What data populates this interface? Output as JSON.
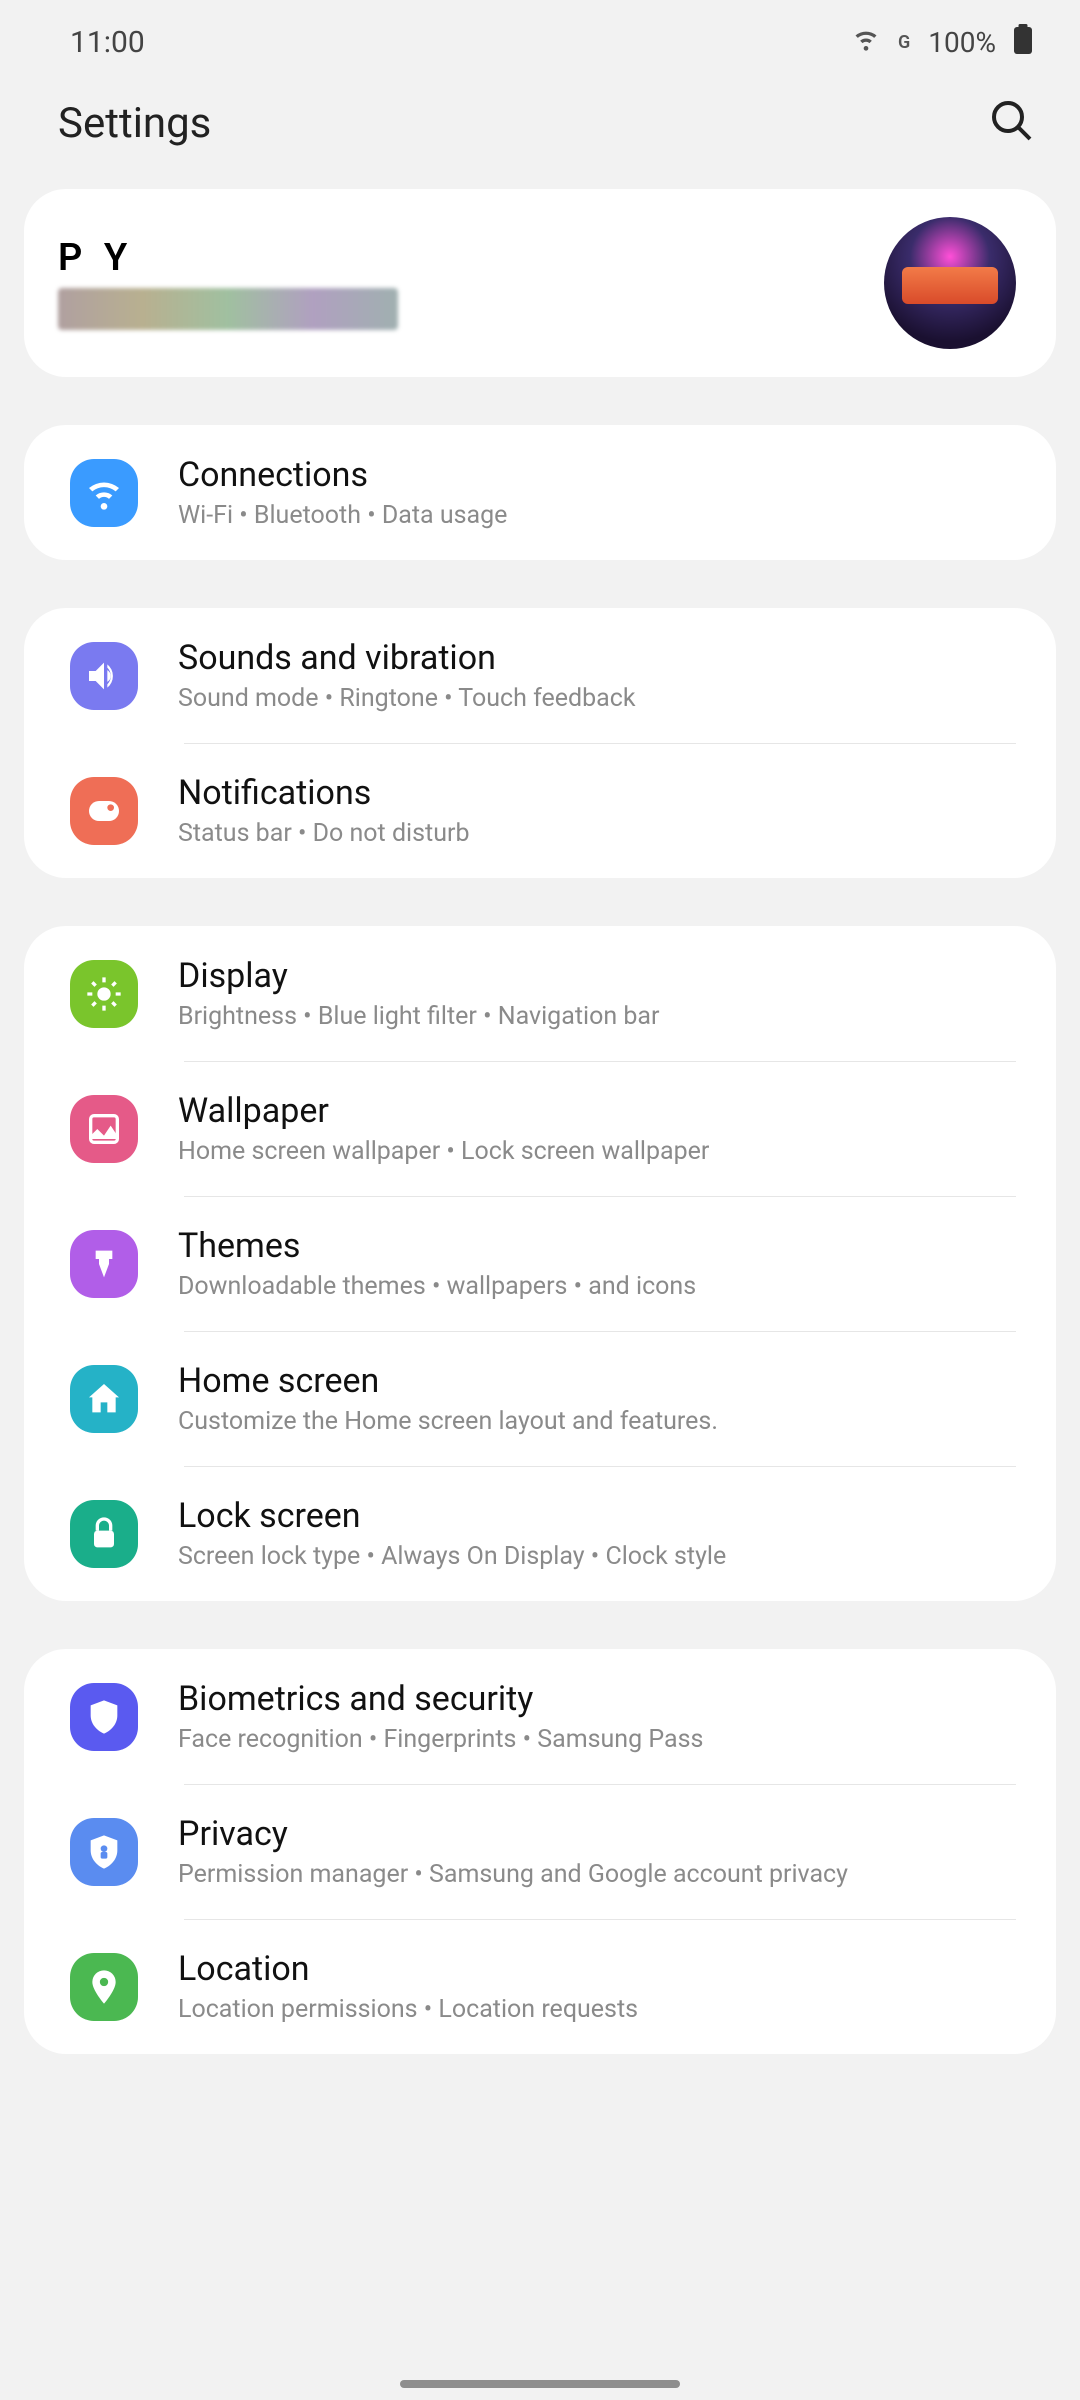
{
  "status": {
    "time": "11:00",
    "network_label": "G",
    "battery": "100%"
  },
  "header": {
    "title": "Settings"
  },
  "profile": {
    "name": "P Y"
  },
  "colors": {
    "connections": "#3a9bff",
    "sounds": "#7a7af0",
    "notifications": "#ef6e56",
    "display": "#7ac52c",
    "wallpaper": "#e55a88",
    "themes": "#b15ee8",
    "homescreen": "#25b2c7",
    "lockscreen": "#1aae8a",
    "biometrics": "#5a5af0",
    "privacy": "#5a8cf0",
    "location": "#4bb851"
  },
  "groups": [
    {
      "items": [
        {
          "key": "connections",
          "title": "Connections",
          "sub": "Wi-Fi  •  Bluetooth  •  Data usage"
        }
      ]
    },
    {
      "items": [
        {
          "key": "sounds",
          "title": "Sounds and vibration",
          "sub": "Sound mode  •  Ringtone  •  Touch feedback"
        },
        {
          "key": "notifications",
          "title": "Notifications",
          "sub": "Status bar  •  Do not disturb"
        }
      ]
    },
    {
      "items": [
        {
          "key": "display",
          "title": "Display",
          "sub": "Brightness  •  Blue light filter  •  Navigation bar"
        },
        {
          "key": "wallpaper",
          "title": "Wallpaper",
          "sub": "Home screen wallpaper  •  Lock screen wallpaper"
        },
        {
          "key": "themes",
          "title": "Themes",
          "sub": "Downloadable themes  •  wallpapers  •  and icons"
        },
        {
          "key": "homescreen",
          "title": "Home screen",
          "sub": "Customize the Home screen layout and features."
        },
        {
          "key": "lockscreen",
          "title": "Lock screen",
          "sub": "Screen lock type  •  Always On Display  •  Clock style"
        }
      ]
    },
    {
      "items": [
        {
          "key": "biometrics",
          "title": "Biometrics and security",
          "sub": "Face recognition  •  Fingerprints  •  Samsung Pass"
        },
        {
          "key": "privacy",
          "title": "Privacy",
          "sub": "Permission manager  •  Samsung and Google account privacy"
        },
        {
          "key": "location",
          "title": "Location",
          "sub": "Location permissions  •  Location requests"
        }
      ]
    }
  ]
}
